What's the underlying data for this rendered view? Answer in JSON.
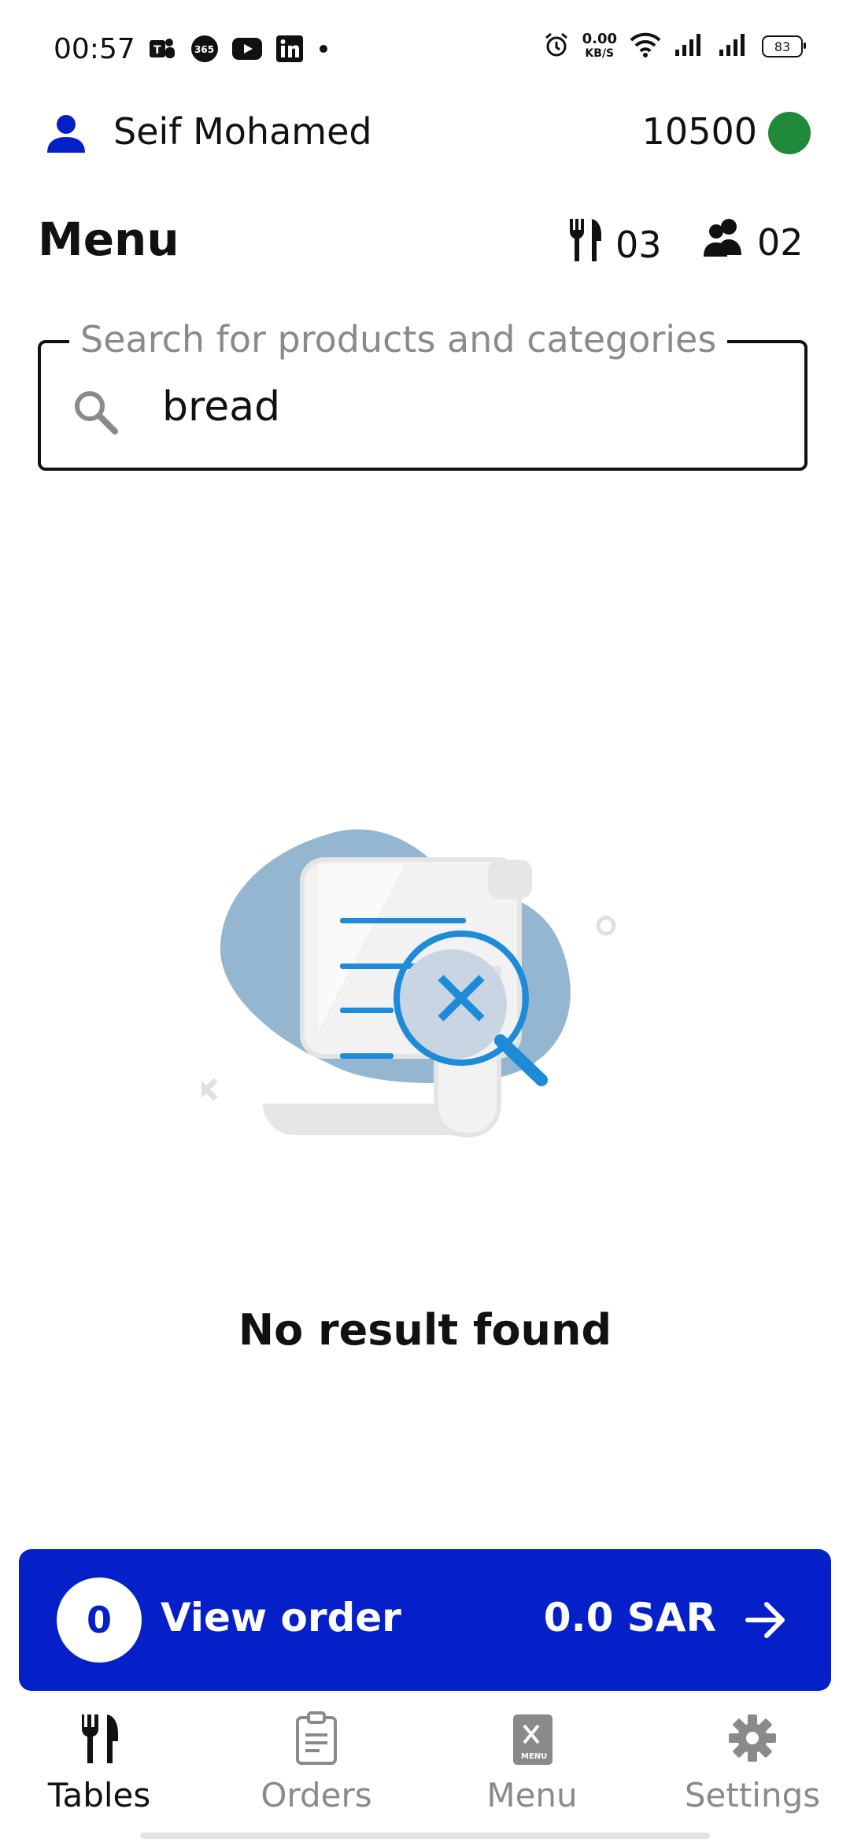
{
  "status_bar": {
    "time": "00:57",
    "app_icons": [
      "teams-icon",
      "office-365-icon",
      "youtube-icon",
      "linkedin-icon"
    ],
    "net_speed_value": "0.00",
    "net_speed_unit": "KB/S",
    "battery": "83"
  },
  "user": {
    "name": "Seif Mohamed",
    "balance": "10500",
    "status_color": "#1f8a3a"
  },
  "menu": {
    "title": "Menu",
    "tables_count": "03",
    "guests_count": "02"
  },
  "search": {
    "label": "Search for products and categories",
    "value": "bread"
  },
  "empty_state": {
    "message": "No result found"
  },
  "order_bar": {
    "item_count": "0",
    "label": "View order",
    "total": "0.0 SAR",
    "color": "#0520c9"
  },
  "bottom_nav": {
    "items": [
      {
        "label": "Tables",
        "icon": "cutlery-icon",
        "active": true
      },
      {
        "label": "Orders",
        "icon": "clipboard-icon",
        "active": false
      },
      {
        "label": "Menu",
        "icon": "menu-book-icon",
        "active": false
      },
      {
        "label": "Settings",
        "icon": "gear-icon",
        "active": false
      }
    ]
  }
}
